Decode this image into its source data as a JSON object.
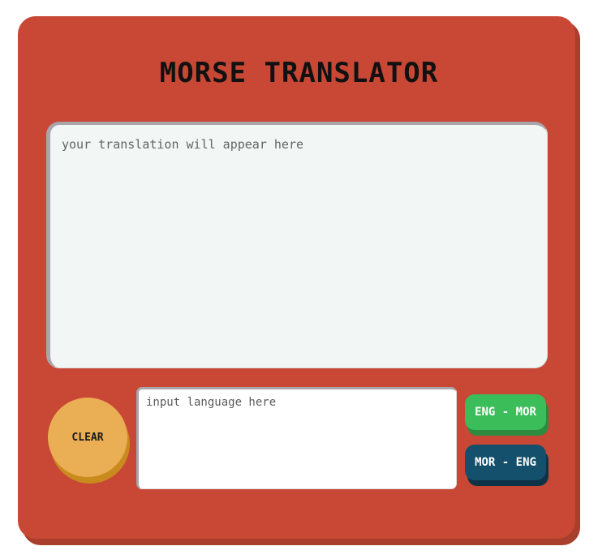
{
  "app": {
    "title": "MORSE TRANSLATOR"
  },
  "output": {
    "placeholder": "your translation will appear here"
  },
  "controls": {
    "clear_label": "CLEAR",
    "input_placeholder": "input language here",
    "eng_to_mor_label": "ENG - MOR",
    "mor_to_eng_label": "MOR - ENG"
  },
  "colors": {
    "frame": "#c94735",
    "clear_button": "#eaae55",
    "eng_to_mor_button": "#3bbd5a",
    "mor_to_eng_button": "#14506b",
    "screen": "#f2f6f4"
  }
}
